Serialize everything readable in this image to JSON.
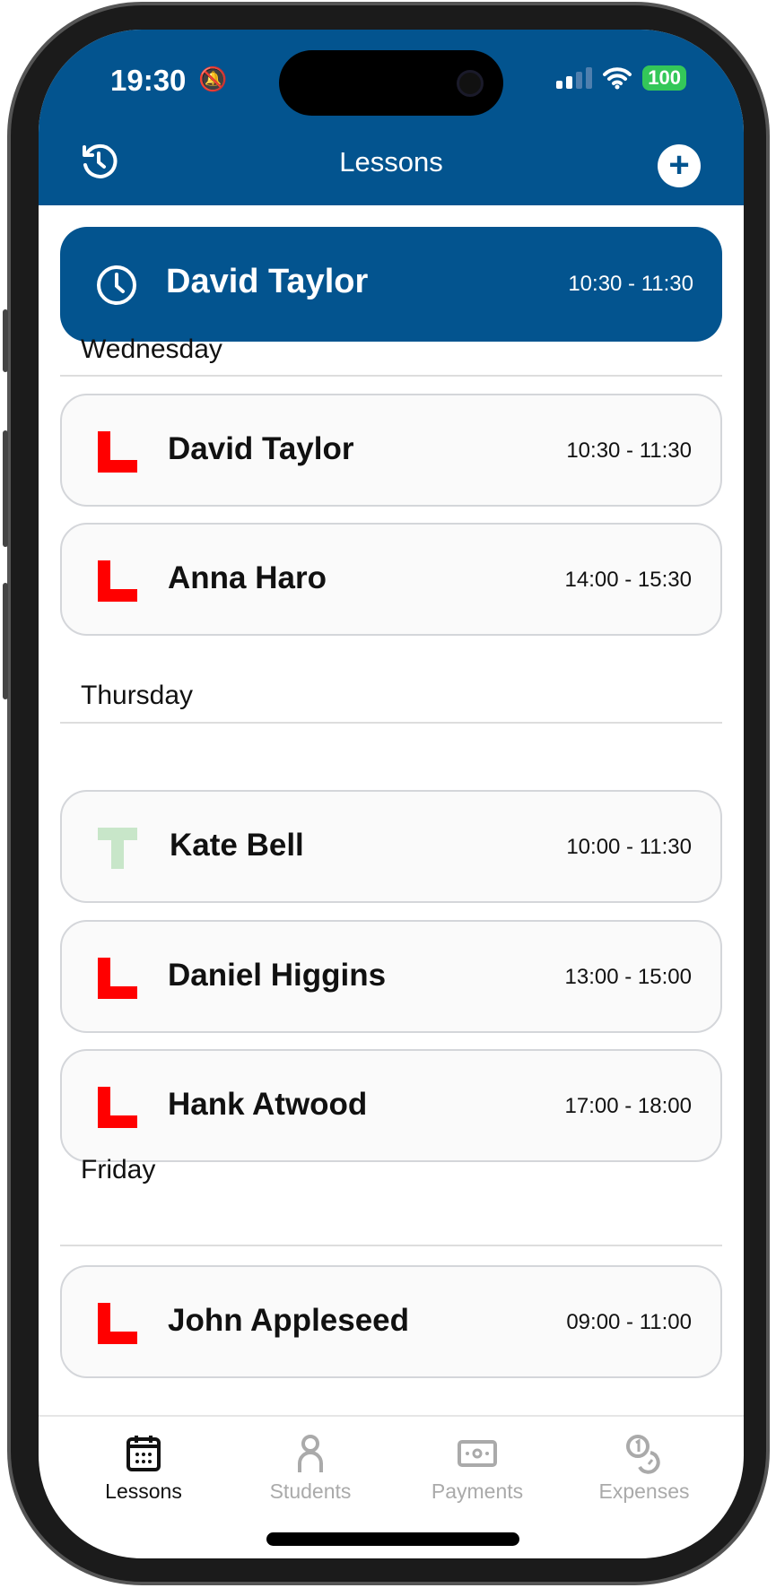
{
  "status_bar": {
    "time": "19:30",
    "battery": "100"
  },
  "header": {
    "title": "Lessons"
  },
  "current_lesson": {
    "name": "David Taylor",
    "time": "10:30 - 11:30"
  },
  "days": [
    {
      "label": "Wednesday",
      "lessons": [
        {
          "name": "David Taylor",
          "time": "10:30 - 11:30",
          "type": "L"
        },
        {
          "name": "Anna Haro",
          "time": "14:00 - 15:30",
          "type": "L"
        }
      ]
    },
    {
      "label": "Thursday",
      "lessons": [
        {
          "name": "Kate Bell",
          "time": "10:00 - 11:30",
          "type": "T"
        },
        {
          "name": "Daniel Higgins",
          "time": "13:00 - 15:00",
          "type": "L"
        },
        {
          "name": "Hank Atwood",
          "time": "17:00 - 18:00",
          "type": "L"
        }
      ]
    },
    {
      "label": "Friday",
      "lessons": [
        {
          "name": "John Appleseed",
          "time": "09:00 - 11:00",
          "type": "L"
        }
      ]
    }
  ],
  "tabs": [
    {
      "label": "Lessons",
      "active": true
    },
    {
      "label": "Students"
    },
    {
      "label": "Payments"
    },
    {
      "label": "Expenses"
    }
  ],
  "colors": {
    "brand": "#03548f",
    "learner": "#ff0000",
    "test": "#c8e6c9"
  }
}
